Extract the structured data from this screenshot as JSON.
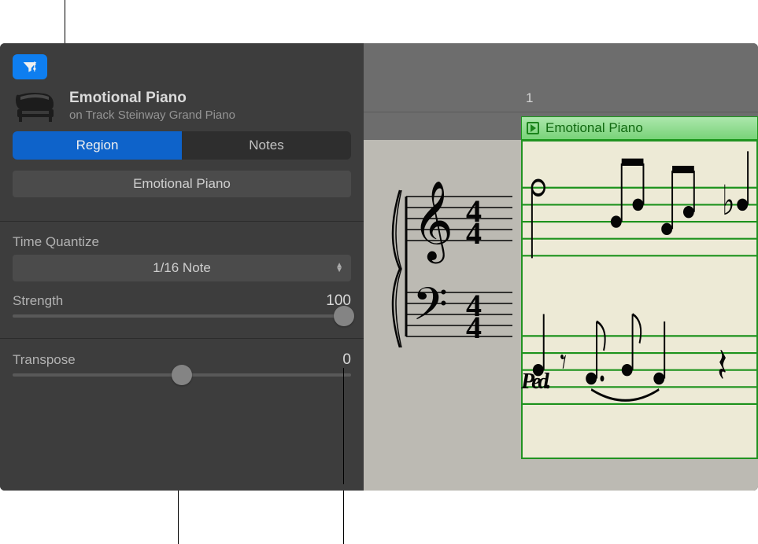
{
  "header": {
    "region_name": "Emotional Piano",
    "track_subtitle": "on Track Steinway Grand Piano"
  },
  "tabs": {
    "region": "Region",
    "notes": "Notes"
  },
  "name_field": "Emotional Piano",
  "time_quantize": {
    "label": "Time Quantize",
    "value": "1/16 Note"
  },
  "strength": {
    "label": "Strength",
    "value": "100",
    "slider_percent": 100
  },
  "transpose": {
    "label": "Transpose",
    "value": "0",
    "slider_percent": 50
  },
  "ruler": {
    "bar_number": "1"
  },
  "score_region": {
    "label": "Emotional Piano"
  },
  "pedal_mark": "Ped.",
  "icons": {
    "filter": "filter-icon",
    "piano": "piano-icon",
    "loop": "loop-icon",
    "popup_arrows": "chevrons-icon"
  },
  "colors": {
    "accent": "#0a84ff",
    "tab_active": "#0a66d6",
    "region_green": "#1f9b1f",
    "panel_bg": "#3d3d3d"
  }
}
